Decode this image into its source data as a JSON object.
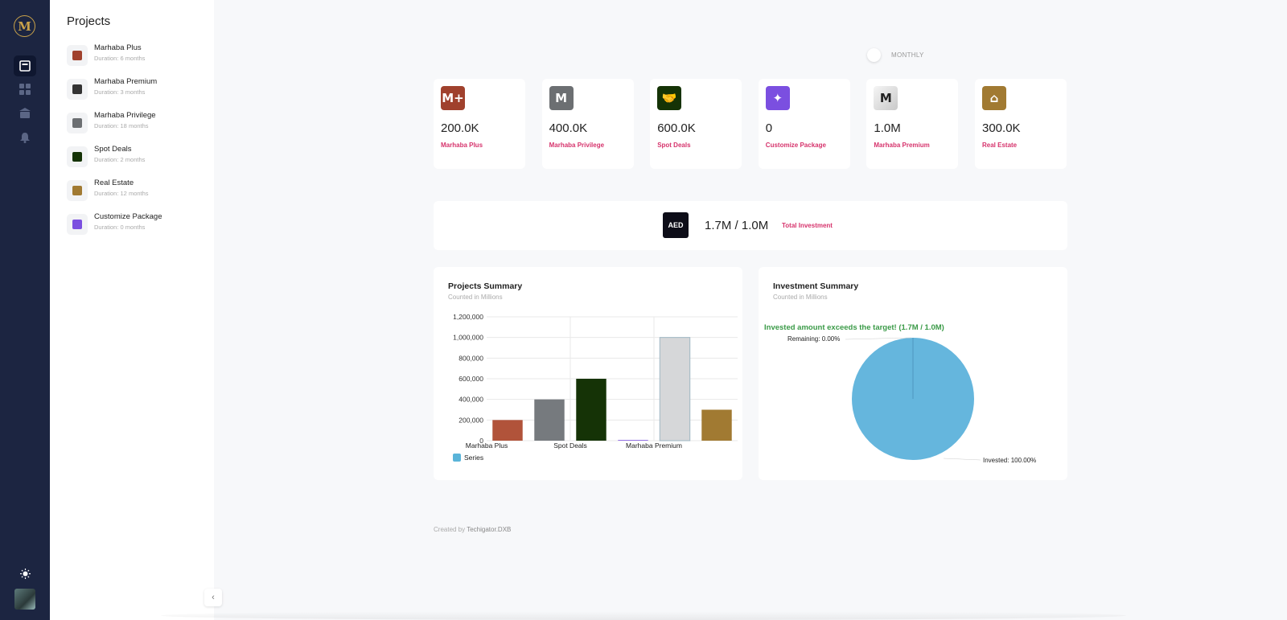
{
  "brand": {
    "logo_letter": "M"
  },
  "sidebar": {
    "title": "Projects",
    "items": [
      {
        "name": "Marhaba Plus",
        "duration": "Duration: 6 months",
        "color": "#a0412d"
      },
      {
        "name": "Marhaba Premium",
        "duration": "Duration: 3 months",
        "color": "#333333"
      },
      {
        "name": "Marhaba Privilege",
        "duration": "Duration: 18 months",
        "color": "#6c6f72"
      },
      {
        "name": "Spot Deals",
        "duration": "Duration: 2 months",
        "color": "#153306"
      },
      {
        "name": "Real Estate",
        "duration": "Duration: 12 months",
        "color": "#a17a32"
      },
      {
        "name": "Customize Package",
        "duration": "Duration: 0 months",
        "color": "#7b4fe0"
      }
    ]
  },
  "rail": {
    "icons": [
      "projects-icon",
      "dashboard-icon",
      "bank-icon",
      "bell-icon",
      "sun-icon",
      "user-avatar"
    ]
  },
  "period_toggle": {
    "label": "MONTHLY"
  },
  "stats": [
    {
      "value": "200.0K",
      "label": "Marhaba Plus",
      "icon_text": "M+",
      "color": "#a0412d"
    },
    {
      "value": "400.0K",
      "label": "Marhaba Privilege",
      "icon_text": "M",
      "color": "#6c6f72"
    },
    {
      "value": "600.0K",
      "label": "Spot Deals",
      "icon_text": "🤝",
      "color": "#153306"
    },
    {
      "value": "0",
      "label": "Customize Package",
      "icon_text": "✦",
      "color": "#7b4fe0"
    },
    {
      "value": "1.0M",
      "label": "Marhaba Premium",
      "icon_text": "M",
      "color": "#e6e6e6"
    },
    {
      "value": "300.0K",
      "label": "Real Estate",
      "icon_text": "⌂",
      "color": "#a17a32"
    }
  ],
  "total": {
    "value": "1.7M / 1.0M",
    "label": "Total Investment",
    "icon_text_pre": "",
    "icon_text": "AED"
  },
  "projects_summary": {
    "title": "Projects Summary",
    "subtitle": "Counted in Millions"
  },
  "investment_summary": {
    "title": "Investment Summary",
    "subtitle": "Counted in Millions",
    "message": "Invested amount exceeds the target! (1.7M / 1.0M)",
    "remaining_label": "Remaining: 0.00%",
    "invested_label": "Invested: 100.00%"
  },
  "footer": {
    "prefix": "Created by",
    "brand": "Techigator.DXB"
  },
  "chart_data": [
    {
      "type": "bar",
      "categories": [
        "Marhaba Plus",
        "Marhaba Privilege",
        "Spot Deals",
        "Customize Package",
        "Marhaba Premium",
        "Real Estate"
      ],
      "x_tick_labels": [
        "Marhaba Plus",
        "Spot Deals",
        "Marhaba Premium"
      ],
      "values": [
        200000,
        400000,
        600000,
        0,
        1000000,
        300000
      ],
      "colors": [
        "#b1533a",
        "#767a7e",
        "#153306",
        "#7b4fe0",
        "#d6d7d9",
        "#a17a32"
      ],
      "y_ticks": [
        "1,200,000",
        "1,000,000",
        "800,000",
        "600,000",
        "400,000",
        "200,000",
        "0"
      ],
      "ylim": [
        0,
        1200000
      ],
      "legend": {
        "name": "Series",
        "color": "#5ab4d9",
        "position": "bottom-left"
      },
      "grid": true
    },
    {
      "type": "pie",
      "labels": [
        "Invested",
        "Remaining"
      ],
      "values": [
        100,
        0
      ],
      "colors": [
        "#65b6dd",
        "#4a90b8"
      ]
    }
  ]
}
